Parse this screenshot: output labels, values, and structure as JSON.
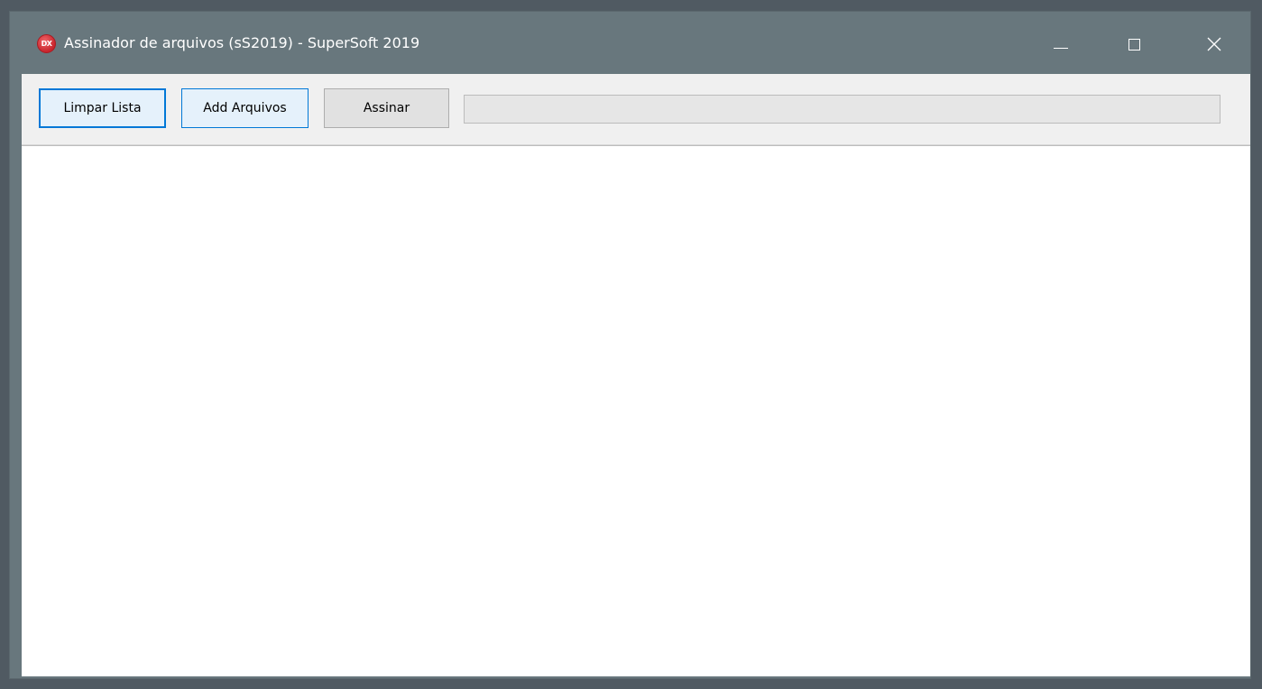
{
  "window": {
    "title": "Assinador de arquivos (sS2019) - SuperSoft 2019",
    "app_icon_label": "DX",
    "icon": "app-logo-icon"
  },
  "controls": {
    "minimize_icon": "minimize-icon",
    "maximize_icon": "maximize-icon",
    "close_icon": "close-icon"
  },
  "toolbar": {
    "limpar_label": "Limpar Lista",
    "add_label": "Add Arquivos",
    "assinar_label": "Assinar"
  },
  "progress": {
    "value": 0
  },
  "file_list": {
    "items": []
  },
  "colors": {
    "titlebar": "#68777d",
    "focus_accent": "#0078d7",
    "toolbar_bg": "#f0f0f0"
  }
}
